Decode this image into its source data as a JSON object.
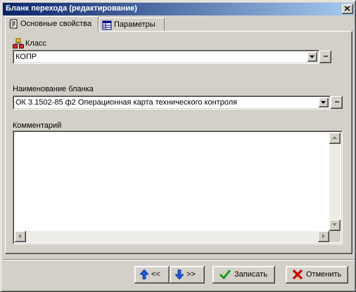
{
  "window": {
    "title": "Бланк перехода (редактирование)"
  },
  "tabs": [
    {
      "label": "Основные свойства",
      "active": true,
      "icon": "properties-icon"
    },
    {
      "label": "Параметры",
      "active": false,
      "icon": "table-icon"
    }
  ],
  "fields": {
    "class": {
      "label": "Класс",
      "value": "КОПР",
      "icon": "class-tree-icon"
    },
    "form_name": {
      "label": "Наименование бланка",
      "value": "ОК 3.1502-85 ф2 Операционная карта технического контроля"
    },
    "comment": {
      "label": "Комментарий",
      "value": ""
    }
  },
  "buttons": {
    "prev": {
      "label": "<<",
      "icon": "arrow-up-icon"
    },
    "next": {
      "label": ">>",
      "icon": "arrow-down-icon"
    },
    "save": {
      "label": "Записать",
      "icon": "checkmark-icon"
    },
    "cancel": {
      "label": "Отменить",
      "icon": "cross-icon"
    },
    "ellipsis": "..."
  },
  "colors": {
    "title_start": "#0a246a",
    "title_end": "#a6caf0",
    "face": "#d4d0c8",
    "save_check": "#1a9a1a",
    "cancel_x": "#cc0000",
    "arrow_blue": "#1e5adc"
  }
}
